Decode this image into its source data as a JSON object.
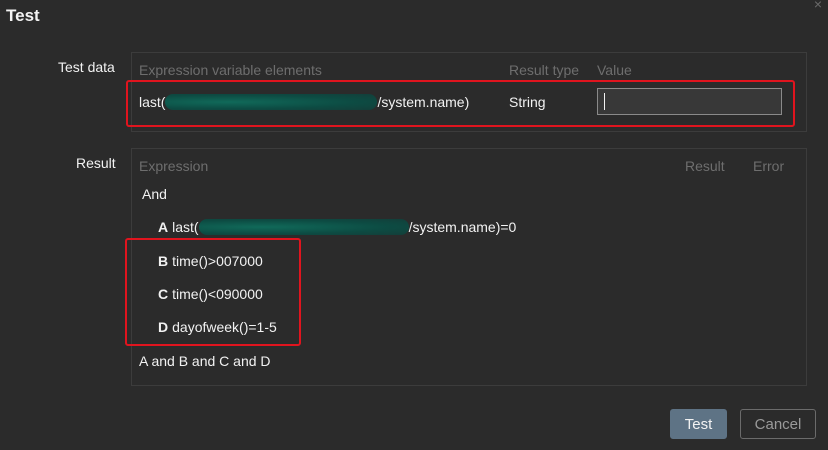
{
  "dialog": {
    "title": "Test",
    "close_glyph": "×"
  },
  "test_data": {
    "label": "Test data",
    "headers": {
      "expression": "Expression variable elements",
      "result_type": "Result type",
      "value": "Value"
    },
    "row": {
      "prefix": "last(",
      "suffix": "/system.name)",
      "result_type": "String",
      "value": ""
    }
  },
  "result": {
    "label": "Result",
    "headers": {
      "expression": "Expression",
      "result": "Result",
      "error": "Error"
    },
    "root_operator": "And",
    "items": [
      {
        "letter": "A",
        "prefix": "last(",
        "suffix": "/system.name)=0"
      },
      {
        "letter": "B",
        "text": "time()>007000"
      },
      {
        "letter": "C",
        "text": "time()<090000"
      },
      {
        "letter": "D",
        "text": "dayofweek()=1-5"
      }
    ],
    "combined": "A and B and C and D"
  },
  "buttons": {
    "test": "Test",
    "cancel": "Cancel"
  },
  "annotation_color": "#e0141e",
  "redaction_color": "#0f6d5c"
}
